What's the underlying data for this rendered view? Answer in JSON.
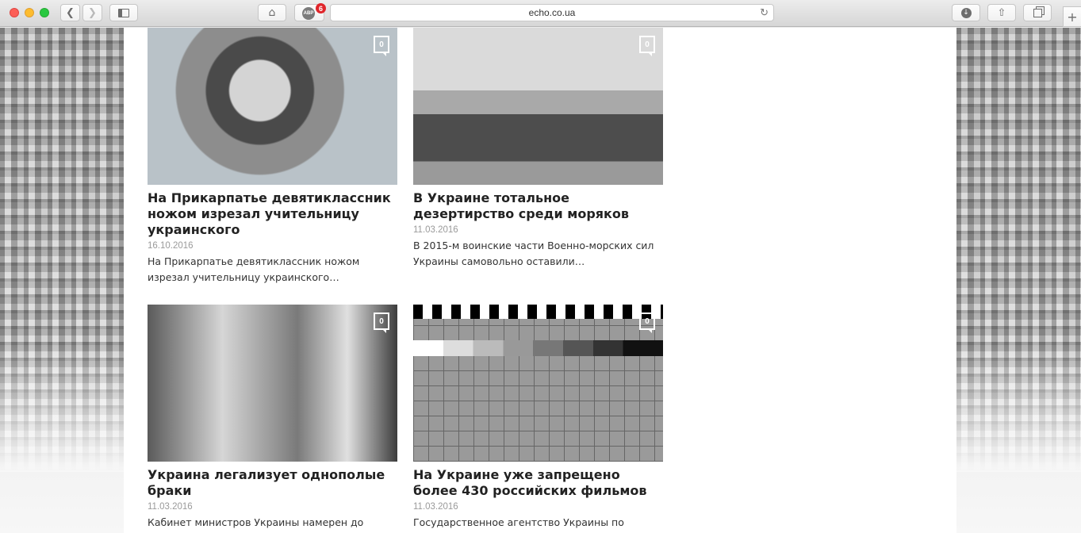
{
  "browser": {
    "url": "echo.co.ua",
    "adblock_count": "6",
    "adblock_label": "ABP"
  },
  "articles": [
    {
      "title": "На Прикарпатье девятиклассник ножом изрезал учительницу украинского",
      "date": "16.10.2016",
      "excerpt": "На Прикарпатье девятиклассник ножом изрезал учительницу украинского…",
      "comments": "0"
    },
    {
      "title": "В Украине тотальное дезертирство среди моряков",
      "date": "11.03.2016",
      "excerpt": "В 2015-м воинские части Военно-морских сил Украины самовольно оставили…",
      "comments": "0"
    },
    {
      "title": "Украина легализует однополые браки",
      "date": "11.03.2016",
      "excerpt": "Кабинет министров Украины намерен до конца",
      "comments": "0"
    },
    {
      "title": "На Украине уже запрещено более 430 российских фильмов",
      "date": "11.03.2016",
      "excerpt": "Государственное агентство Украины по",
      "comments": "0"
    }
  ]
}
